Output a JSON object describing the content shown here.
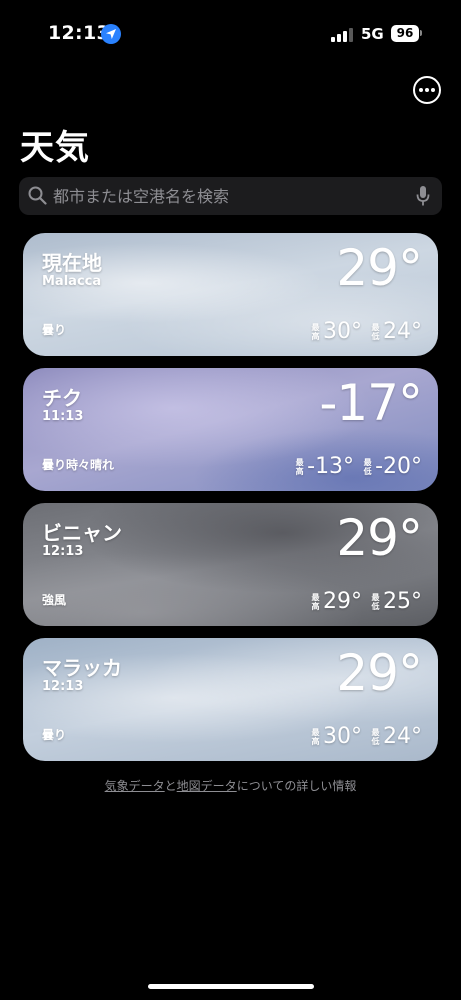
{
  "status_bar": {
    "time": "12:13",
    "network": "5G",
    "battery": "96"
  },
  "icons": {
    "location": "location-arrow-icon",
    "signal": "cellular-signal-icon",
    "battery": "battery-icon",
    "more": "ellipsis-circle-icon",
    "search": "magnifying-glass-icon",
    "mic": "microphone-icon"
  },
  "header": {
    "title": "天気"
  },
  "search": {
    "placeholder": "都市または空港名を検索"
  },
  "labels": {
    "high": "最高",
    "low": "最低"
  },
  "locations": [
    {
      "name": "現在地",
      "subtitle": "Malacca",
      "temp": "29°",
      "condition": "曇り",
      "high": "30°",
      "low": "24°"
    },
    {
      "name": "チク",
      "subtitle": "11:13",
      "temp": "-17°",
      "condition": "曇り時々晴れ",
      "high": "-13°",
      "low": "-20°"
    },
    {
      "name": "ビニャン",
      "subtitle": "12:13",
      "temp": "29°",
      "condition": "強風",
      "high": "29°",
      "low": "25°"
    },
    {
      "name": "マラッカ",
      "subtitle": "12:13",
      "temp": "29°",
      "condition": "曇り",
      "high": "30°",
      "low": "24°"
    }
  ],
  "footer": {
    "link1": "気象データ",
    "connector": "と",
    "link2": "地図データ",
    "suffix": "についての詳しい情報"
  },
  "colors": {
    "background": "#000000",
    "search_bg": "#1c1c1e",
    "placeholder": "#8e8e93",
    "location_blue": "#2a82ff"
  }
}
